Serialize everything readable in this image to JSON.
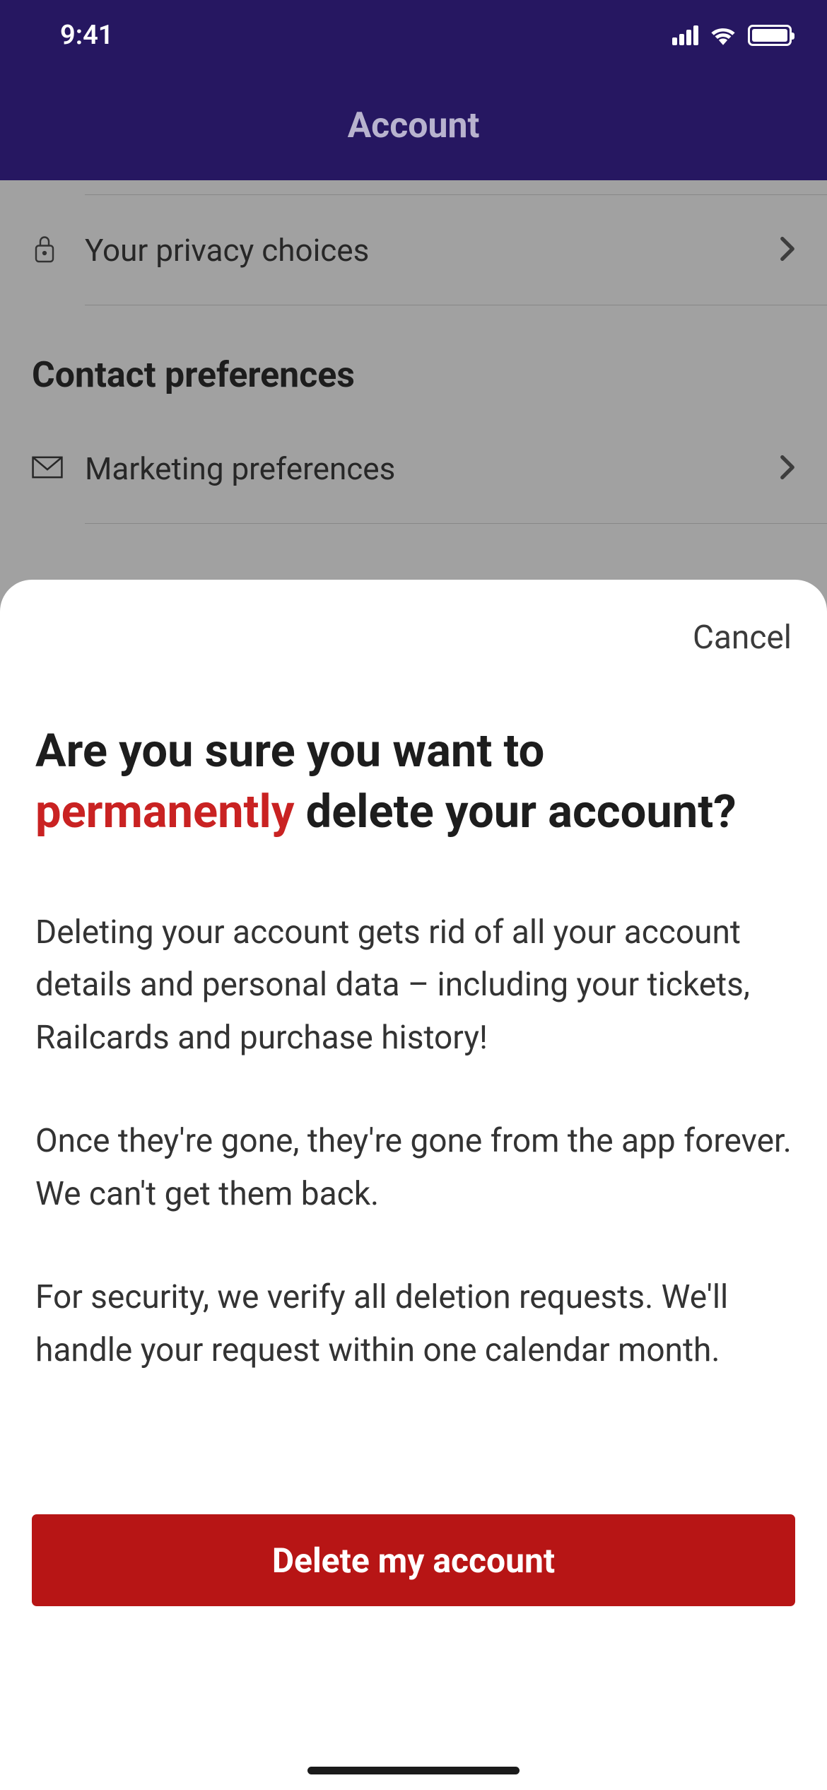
{
  "status": {
    "time": "9:41"
  },
  "header": {
    "title": "Account"
  },
  "background": {
    "rows": [
      {
        "label": "Your privacy choices"
      }
    ],
    "section_header": "Contact preferences",
    "rows2": [
      {
        "label": "Marketing preferences"
      }
    ]
  },
  "modal": {
    "cancel": "Cancel",
    "title_part1": "Are you sure you want to ",
    "title_emphasis": "permanently",
    "title_part2": " delete your account?",
    "body": {
      "p1": "Deleting your account gets rid of all your account details and personal data – including your tickets, Railcards and purchase history!",
      "p2": "Once they're gone, they're gone from the app forever. We can't get them back.",
      "p3": "For security, we verify all deletion requests. We'll handle your request within one calendar month."
    },
    "delete_button": "Delete my account"
  }
}
